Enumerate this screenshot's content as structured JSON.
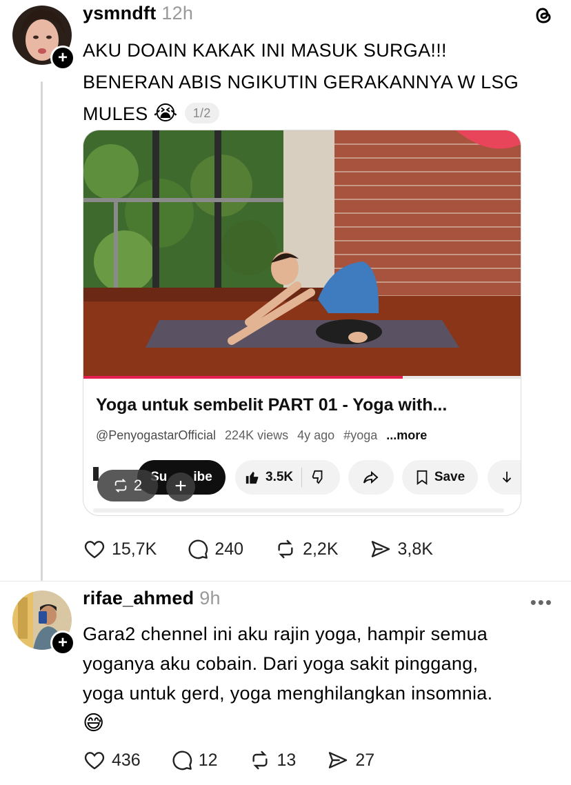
{
  "post1": {
    "username": "ysmndft",
    "time": "12h",
    "text_line1": "AKU DOAIN KAKAK INI MASUK SURGA!!!",
    "text_line2": "BENERAN ABIS NGIKUTIN GERAKANNYA W LSG",
    "text_line3": "MULES",
    "emoji": "😭",
    "page_indicator": "1/2",
    "video_card": {
      "title": "Yoga untuk sembelit PART 01 - Yoga with...",
      "channel": "@PenyogastarOfficial",
      "views": "224K views",
      "age": "4y ago",
      "hashtag": "#yoga",
      "more": "...more",
      "subscribe_label": "Subscribe",
      "subscribe_visible_left": "Su",
      "subscribe_visible_right": "ibe",
      "likes": "3.5K",
      "save_label": "Save",
      "repost_overlay_count": "2",
      "progress": 0.73
    },
    "stats": {
      "likes": "15,7K",
      "replies": "240",
      "reposts": "2,2K",
      "shares": "3,8K"
    }
  },
  "post2": {
    "username": "rifae_ahmed",
    "time": "9h",
    "text_line1": "Gara2 chennel ini aku rajin yoga, hampir semua",
    "text_line2": "yoganya aku cobain. Dari yoga sakit pinggang,",
    "text_line3": "yoga untuk gerd, yoga menghilangkan insomnia.",
    "emoji": "😅",
    "stats": {
      "likes": "436",
      "replies": "12",
      "reposts": "13",
      "shares": "27"
    }
  },
  "icons": {
    "threads": "threads-logo-icon",
    "like": "heart-icon",
    "reply": "comment-icon",
    "repost": "repost-icon",
    "share": "send-icon",
    "more": "more-options-icon"
  },
  "colors": {
    "accent": "#000000",
    "muted": "#999999",
    "video_progress": "#e3204f"
  }
}
